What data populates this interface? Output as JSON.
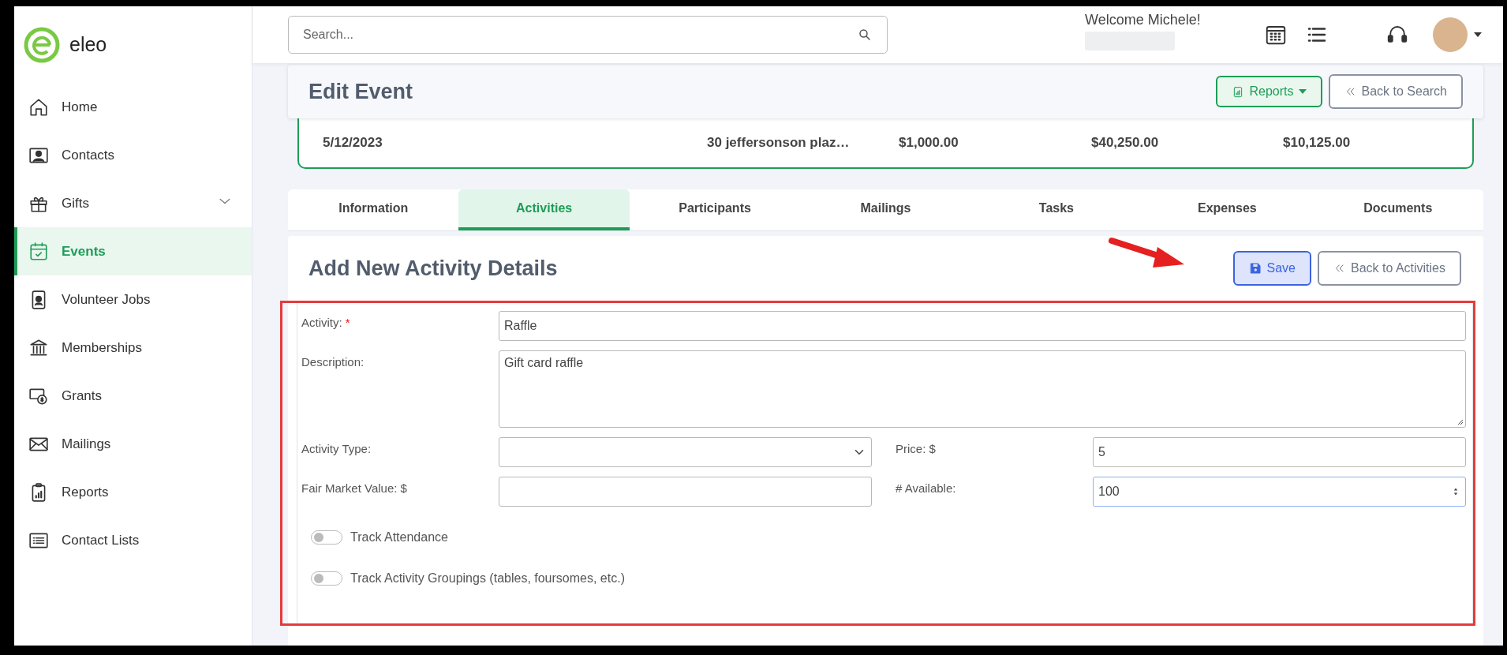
{
  "brand": {
    "name": "eleo"
  },
  "sidebar": {
    "items": [
      {
        "label": "Home",
        "kind": "home",
        "selected": false,
        "submenu": false
      },
      {
        "label": "Contacts",
        "kind": "contacts",
        "selected": false,
        "submenu": false
      },
      {
        "label": "Gifts",
        "kind": "gifts",
        "selected": false,
        "submenu": true
      },
      {
        "label": "Events",
        "kind": "events",
        "selected": true,
        "submenu": false
      },
      {
        "label": "Volunteer Jobs",
        "kind": "volunteer",
        "selected": false,
        "submenu": false
      },
      {
        "label": "Memberships",
        "kind": "memberships",
        "selected": false,
        "submenu": false
      },
      {
        "label": "Grants",
        "kind": "grants",
        "selected": false,
        "submenu": false
      },
      {
        "label": "Mailings",
        "kind": "mailings",
        "selected": false,
        "submenu": false
      },
      {
        "label": "Reports",
        "kind": "reports",
        "selected": false,
        "submenu": false
      },
      {
        "label": "Contact Lists",
        "kind": "lists",
        "selected": false,
        "submenu": false
      }
    ]
  },
  "topbar": {
    "search": {
      "placeholder": "Search..."
    },
    "welcome": "Welcome Michele!"
  },
  "page_header": {
    "title": "Edit Event",
    "buttons": [
      {
        "label": "Reports",
        "kind": "dropdown"
      },
      {
        "label": "Back to Search",
        "kind": "back"
      }
    ]
  },
  "summary": {
    "values": [
      "5/12/2023",
      "30 jeffersonson plaz…",
      "$1,000.00",
      "$40,250.00",
      "$10,125.00"
    ]
  },
  "tabs": [
    {
      "label": "Information",
      "selected": false
    },
    {
      "label": "Activities",
      "selected": true
    },
    {
      "label": "Participants",
      "selected": false
    },
    {
      "label": "Mailings",
      "selected": false
    },
    {
      "label": "Tasks",
      "selected": false
    },
    {
      "label": "Expenses",
      "selected": false
    },
    {
      "label": "Documents",
      "selected": false
    }
  ],
  "form": {
    "title": "Add New Activity Details",
    "buttons": [
      {
        "label": "Save",
        "kind": "save"
      },
      {
        "label": "Back to Activities",
        "kind": "back"
      }
    ],
    "rows": [
      [
        {
          "label": "Activity:",
          "required_mark": "*",
          "kind": "text",
          "value": "Raffle",
          "focused": false
        }
      ],
      [
        {
          "label": "Description:",
          "kind": "textarea",
          "value": "Gift card raffle",
          "focused": false
        }
      ],
      [
        {
          "label": "Activity Type:",
          "kind": "select",
          "focused": false
        },
        {
          "label": "Price: $",
          "kind": "text",
          "value": "5",
          "focused": false
        }
      ],
      [
        {
          "label": "Fair Market Value: $",
          "kind": "text",
          "focused": false
        },
        {
          "label": "# Available:",
          "kind": "number",
          "value": "100",
          "focused": true
        }
      ]
    ],
    "toggles": [
      {
        "label": "Track Attendance",
        "on": false
      },
      {
        "label": "Track Activity Groupings (tables, foursomes, etc.)",
        "on": false
      }
    ]
  }
}
